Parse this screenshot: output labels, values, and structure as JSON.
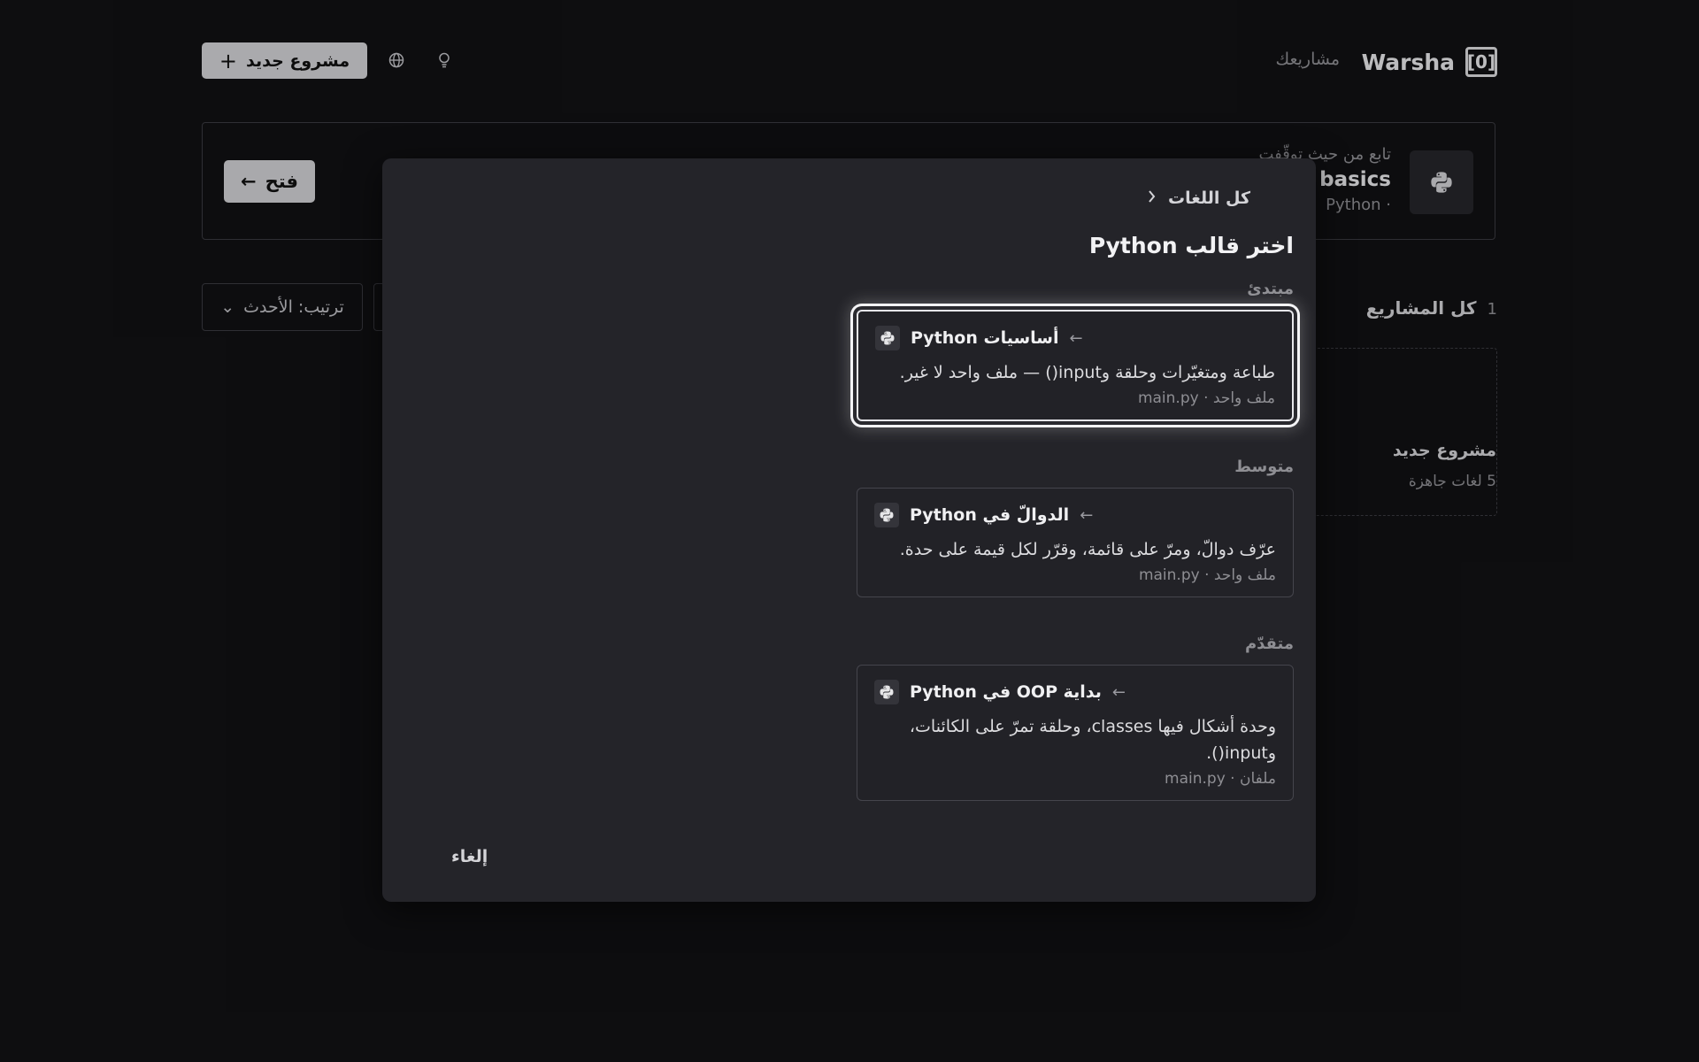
{
  "header": {
    "logo_text": "Warsha",
    "logo_mark": "[0]",
    "nav_projects": "مشاريعك",
    "new_project_label": "مشروع جديد",
    "icons": [
      "globe-icon",
      "lightbulb-icon",
      "plus-icon"
    ]
  },
  "resume": {
    "subtitle": "تابع من حيث توقّفت",
    "title": "Python basics",
    "meta": "Python ·",
    "open_label": "فتح"
  },
  "projects": {
    "heading": "كل المشاريع",
    "count": "1",
    "sort_label": "ترتيب: الأحدث",
    "card_title": "مشروع جديد",
    "card_sub": "5 لغات جاهزة"
  },
  "modal": {
    "back_label": "كل اللغات",
    "title": "اختر قالب Python",
    "cancel_label": "إلغاء",
    "levels": [
      {
        "label": "مبتدئ",
        "template": {
          "title": "أساسيات Python",
          "description": "طباعة ومتغيّرات وحلقة وinput() — ملف واحد لا غير.",
          "meta": "ملف واحد · main.py",
          "selected": true
        }
      },
      {
        "label": "متوسط",
        "template": {
          "title": "الدوالّ في Python",
          "description": "عرّف دوالّ، ومرّ على قائمة، وقرّر لكل قيمة على حدة.",
          "meta": "ملف واحد · main.py",
          "selected": false
        }
      },
      {
        "label": "متقدّم",
        "template": {
          "title": "بداية OOP في Python",
          "description": "وحدة أشكال فيها classes، وحلقة تمرّ على الكائنات، وinput().",
          "meta": "ملفان · main.py",
          "selected": false
        }
      }
    ]
  }
}
